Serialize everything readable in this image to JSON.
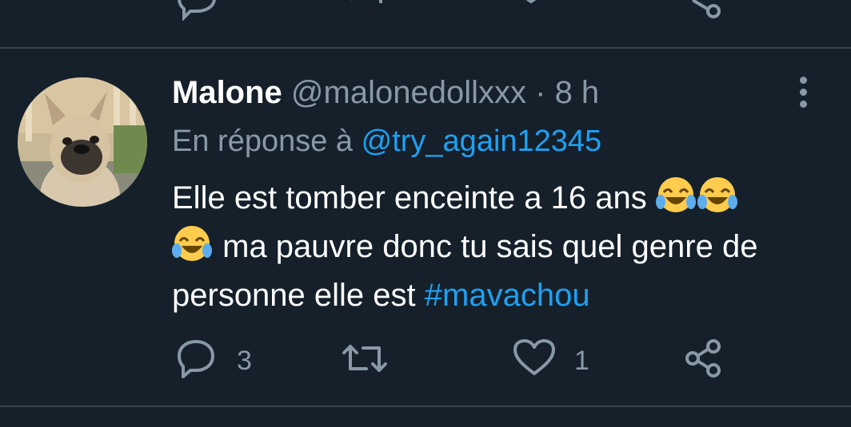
{
  "previous_tweet": {
    "actions": [
      "reply-icon",
      "retweet-icon",
      "like-icon",
      "share-icon"
    ]
  },
  "tweet": {
    "author_name": "Malone",
    "author_handle": "@malonedollxxx",
    "separator": "·",
    "time": "8 h",
    "reply_prefix": "En réponse à",
    "reply_mention": "@try_again12345",
    "text_line1": "Elle est tomber enceinte a 16 ans",
    "text_line2": "ma pauvre donc tu sais quel genre de",
    "text_line3": "personne elle est",
    "hashtag": "#mavachou",
    "emoji": "face-with-tears-of-joy",
    "reply_count": "3",
    "retweet_count": "",
    "like_count": "1"
  },
  "colors": {
    "background": "#15202b",
    "text": "#ffffff",
    "secondary": "#8899a6",
    "link": "#1da1f2",
    "divider": "#38444d"
  }
}
